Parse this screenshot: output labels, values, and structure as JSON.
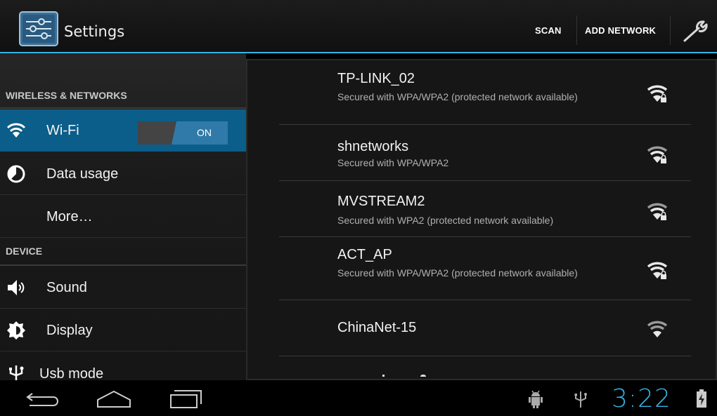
{
  "actionbar": {
    "title": "Settings",
    "scan_label": "SCAN",
    "add_network_label": "ADD NETWORK",
    "icons": {
      "app": "settings-icon",
      "tools": "wrench-icon"
    }
  },
  "sidebar": {
    "sections": [
      {
        "header": "WIRELESS & NETWORKS"
      },
      {
        "header": "DEVICE"
      }
    ],
    "items": [
      {
        "label": "Wi-Fi",
        "icon": "wifi-icon",
        "selected": true,
        "toggle": "ON"
      },
      {
        "label": "Data usage",
        "icon": "data-usage-icon"
      },
      {
        "label": "More…",
        "icon": ""
      },
      {
        "label": "Sound",
        "icon": "speaker-icon"
      },
      {
        "label": "Display",
        "icon": "brightness-icon"
      },
      {
        "label": "Usb mode",
        "icon": "usb-icon"
      }
    ]
  },
  "networks": [
    {
      "ssid": "TP-LINK_02",
      "status": "Secured with WPA/WPA2 (protected network available)",
      "secured": true
    },
    {
      "ssid": "shnetworks",
      "status": "Secured with WPA/WPA2",
      "secured": true
    },
    {
      "ssid": "MVSTREAM2",
      "status": "Secured with WPA2 (protected network available)",
      "secured": true
    },
    {
      "ssid": "ACT_AP",
      "status": "Secured with WPA/WPA2 (protected network available)",
      "secured": true
    },
    {
      "ssid": "ChinaNet-15",
      "status": "",
      "secured": false
    }
  ],
  "systembar": {
    "time": "3:22",
    "icons": [
      "back-icon",
      "home-icon",
      "recent-apps-icon",
      "android-debug-icon",
      "usb-icon",
      "battery-charging-icon"
    ]
  },
  "colors": {
    "accent": "#33b5e5",
    "selected": "#0b5d8a",
    "toggle_on": "#2f7aa8"
  }
}
